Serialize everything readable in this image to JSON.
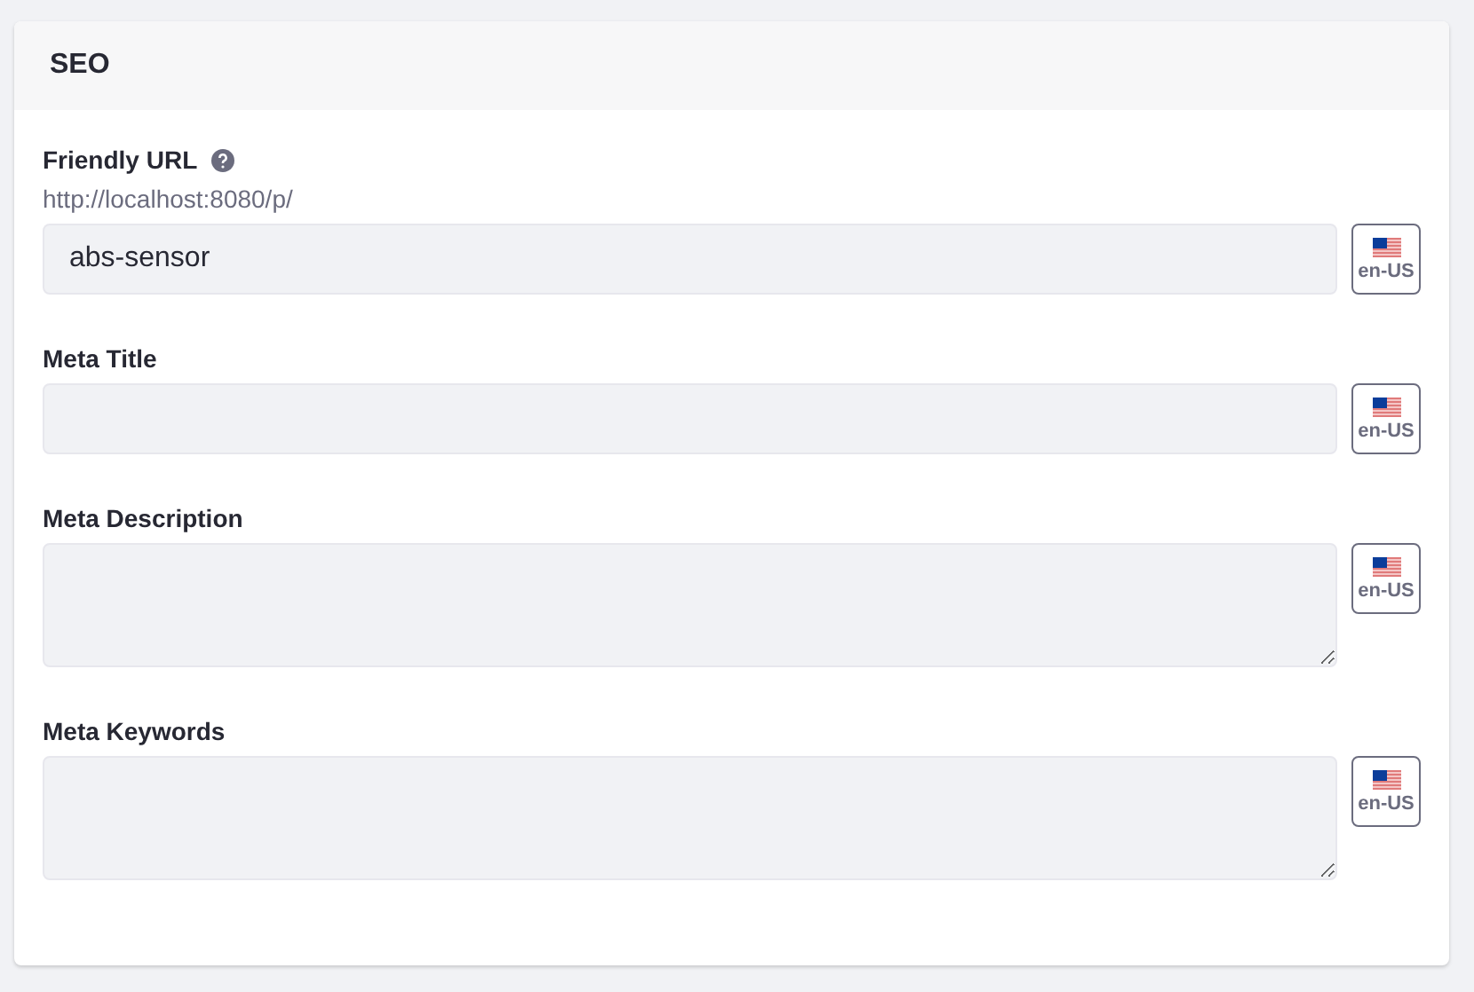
{
  "panel": {
    "title": "SEO"
  },
  "fields": [
    {
      "kind": "input",
      "label": "Friendly URL",
      "help": true,
      "prefix": "http://localhost:8080/p/",
      "value": "abs-sensor",
      "locale": "en-US"
    },
    {
      "kind": "input",
      "label": "Meta Title",
      "help": false,
      "locale": "en-US"
    },
    {
      "kind": "textarea",
      "label": "Meta Description",
      "help": false,
      "locale": "en-US"
    },
    {
      "kind": "textarea",
      "label": "Meta Keywords",
      "help": false,
      "locale": "en-US"
    }
  ]
}
